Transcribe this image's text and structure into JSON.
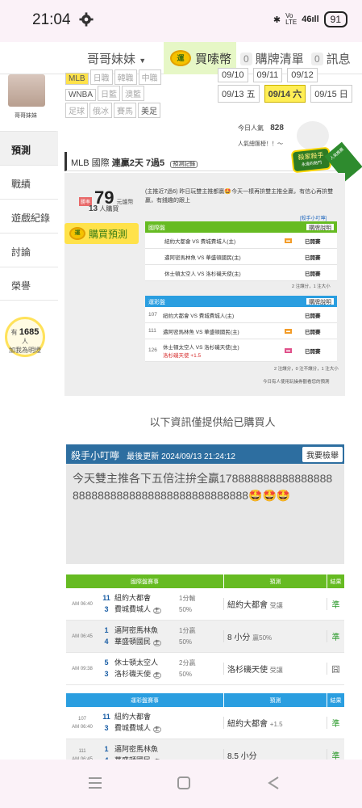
{
  "status": {
    "time": "21:04",
    "signal": "46",
    "battery": "91"
  },
  "nav": {
    "user": "哥哥妹妹",
    "buy_coin": "買嗦幣",
    "cart_count": "0",
    "cart": "購牌清單",
    "msg_count": "0",
    "msg": "訊息"
  },
  "sidebar": {
    "avatar_name": "哥哥妹妹",
    "items": [
      {
        "label": "預測"
      },
      {
        "label": "戰績"
      },
      {
        "label": "遊戲紀錄"
      },
      {
        "label": "討論"
      },
      {
        "label": "榮譽"
      }
    ],
    "fans_prefix": "有",
    "fans_count": "1685",
    "fans_suffix": "人",
    "fans_caption": "加我為明燈"
  },
  "league_chips": {
    "row1": [
      "MLB",
      "日職",
      "韓職",
      "中職"
    ],
    "row2": [
      "WNBA",
      "日籃",
      "澳籃"
    ],
    "row3": [
      "足球",
      "俄冰",
      "賽馬",
      "美足"
    ]
  },
  "dates": {
    "row1": [
      "09/10",
      "09/11",
      "09/12"
    ],
    "row2": [
      {
        "label": "09/13 五",
        "active": false
      },
      {
        "label": "09/14 六",
        "active": true
      },
      {
        "label": "09/15 日",
        "active": false
      }
    ]
  },
  "popularity": {
    "today_label": "今日人氣",
    "today_value": "828",
    "total_label": "人氣總匯榜！！～"
  },
  "headline": {
    "league": "MLB 國際",
    "streak": "連贏2天 7過5",
    "tag": "預測記錄",
    "badge_main": "殺家殺手",
    "badge_sub": "永遠的熱門",
    "badge_ribbon": "人氣推薦"
  },
  "panel": {
    "prefix": "勝率",
    "pct": "79",
    "pct_suffix": "元爐幣",
    "buyers": "13",
    "buyers_suffix": "人購買",
    "buy_btn": "購買預測",
    "desc": "(主推近7過6) 昨日玩雙主推都贏🤩今天一樣再拚雙主推全贏，有信心再拚雙贏，有錢趣的跟上",
    "hint_link": "[殺手小叮嚀]",
    "green_table": {
      "title": "國際盤",
      "action": "購牌說明",
      "rows": [
        {
          "text": "紐約大都會 VS 費城費城人(主)",
          "status": "已開賽"
        },
        {
          "text": "邁阿密馬林魚 VS 華盛頓國民(主)",
          "status": "已開賽"
        },
        {
          "text": "休士頓太空人 VS 洛杉磯天使(主)",
          "status": "已開賽"
        }
      ],
      "footer": "2 注讓分，1 注大小"
    },
    "blue_table": {
      "title": "運彩盤",
      "action": "購牌說明",
      "rows": [
        {
          "no": "107",
          "text": "紐約大都會 VS 費城費城人(主)",
          "extra": "",
          "status": "已開賽"
        },
        {
          "no": "111",
          "text": "邁阿密馬林魚 VS 華盛頓國民(主)",
          "extra": "",
          "status": "已開賽"
        },
        {
          "no": "126",
          "text": "休士頓太空人 VS 洛杉磯天使(主)",
          "extra": "洛杉磯天使 +1.5",
          "status": "已開賽"
        }
      ],
      "footer": "2 注讓分，0 注不讓分，1 注大小",
      "note": "今日有人使用玩操券觀看您的預測"
    }
  },
  "info_line": "以下資訊僅提供給已購買人",
  "tip": {
    "title": "殺手小叮嚀",
    "updated_label": "最後更新",
    "updated": "2024/09/13 21:24:12",
    "report_btn": "我要檢舉",
    "body": "今天雙主推各下五倍注拚全贏1788888888888888888888888888888888888888888888🤩🤩🤩"
  },
  "results_green": {
    "headers": [
      "國際盤賽事",
      "預測",
      "結果"
    ],
    "rows": [
      {
        "time": "AM 06:40",
        "n1": "11",
        "t1": "紐約大都會",
        "n2": "3",
        "t2": "費城費城人",
        "handicap": "1分輸",
        "pct": "50%",
        "pick": "紐約大都會",
        "pick_note": "受讓",
        "result": "準"
      },
      {
        "time": "AM 06:45",
        "n1": "1",
        "t1": "邁阿密馬林魚",
        "n2": "4",
        "t2": "華盛頓國民",
        "handicap": "1分贏",
        "pct": "50%",
        "pick": "8 小分",
        "pick_note": "贏50%",
        "result": "準"
      },
      {
        "time": "AM 09:38",
        "n1": "5",
        "t1": "休士頓太空人",
        "n2": "3",
        "t2": "洛杉磯天使",
        "handicap": "2分贏",
        "pct": "50%",
        "pick": "洛杉磯天使",
        "pick_note": "受讓",
        "result": "囧"
      }
    ]
  },
  "results_blue": {
    "headers": [
      "運彩盤賽事",
      "預測",
      "結果"
    ],
    "rows": [
      {
        "no": "107",
        "time": "AM 06:40",
        "n1": "11",
        "t1": "紐約大都會",
        "n2": "3",
        "t2": "費城費城人",
        "pick": "紐約大都會",
        "pick_note": "+1.5",
        "result": "準"
      },
      {
        "no": "111",
        "time": "AM 06:45",
        "n1": "1",
        "t1": "邁阿密馬林魚",
        "n2": "4",
        "t2": "華盛頓國民",
        "pick": "8.5 小分",
        "pick_note": "",
        "result": "準"
      }
    ]
  },
  "colors": {
    "green": "#66bb22",
    "blue": "#2a9ee0",
    "tip_blue": "#2d6ea0",
    "win_green": "#2b9a2b"
  }
}
